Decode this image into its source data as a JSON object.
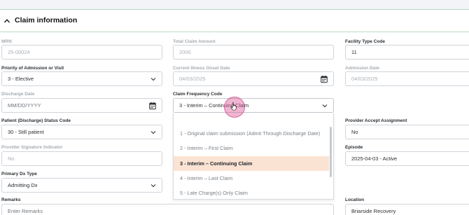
{
  "section": {
    "title": "Claim information"
  },
  "left": {
    "mrn_label": "MRN",
    "mrn_value": "25-00024",
    "priority_label": "Priority of Admission or Visit",
    "priority_value": "3 - Elective",
    "discharge_date_label": "Discharge Date",
    "discharge_date_placeholder": "MM/DD/YYYY",
    "discharge_status_label": "Patient (Discharge) Status Code",
    "discharge_status_value": "30 - Still patient",
    "signature_label": "Provider Signature Indicator",
    "signature_value": "No",
    "primary_dx_label": "Primary Dx Type",
    "primary_dx_value": "Admitting Dx",
    "remarks_label": "Remarks",
    "remarks_placeholder": "Enter Remarks"
  },
  "middle": {
    "total_claim_label": "Total Claim Amount",
    "total_claim_value": "2000",
    "onset_label": "Current Illness Onset Date",
    "onset_value": "04/03/2025",
    "frequency_label": "Claim Frequency Code",
    "frequency_value": "3 - Interim – Continuing Claim",
    "frequency_options": [
      "1 - Original claim submission (Admit Through Discharge Date)",
      "2 - Interim – First Claim",
      "3 - Interim – Continuing Claim",
      "4 - Interim – Last Claim",
      "5 - Late Charge(s) Only Claim"
    ],
    "frequency_selected_index": 2
  },
  "right": {
    "facility_label": "Facility Type Code",
    "facility_value": "11",
    "admission_label": "Admission Date",
    "admission_value": "04/03/2025",
    "accept_label": "Provider Accept Assignment",
    "accept_value": "No",
    "episode_label": "Episode",
    "episode_value": "2025-04-03 - Active",
    "location_label": "Location",
    "location_value": "Briarside Recovery"
  },
  "icons": {
    "collapse": "chevron-up-icon",
    "dropdown": "chevron-down-icon",
    "date": "calendar-icon",
    "pointer": "hand-pointer-icon"
  },
  "colors": {
    "divider_green": "#b9dcbf",
    "selected_option_bg": "#fbe3d4",
    "cursor_highlight": "#de5c96"
  }
}
